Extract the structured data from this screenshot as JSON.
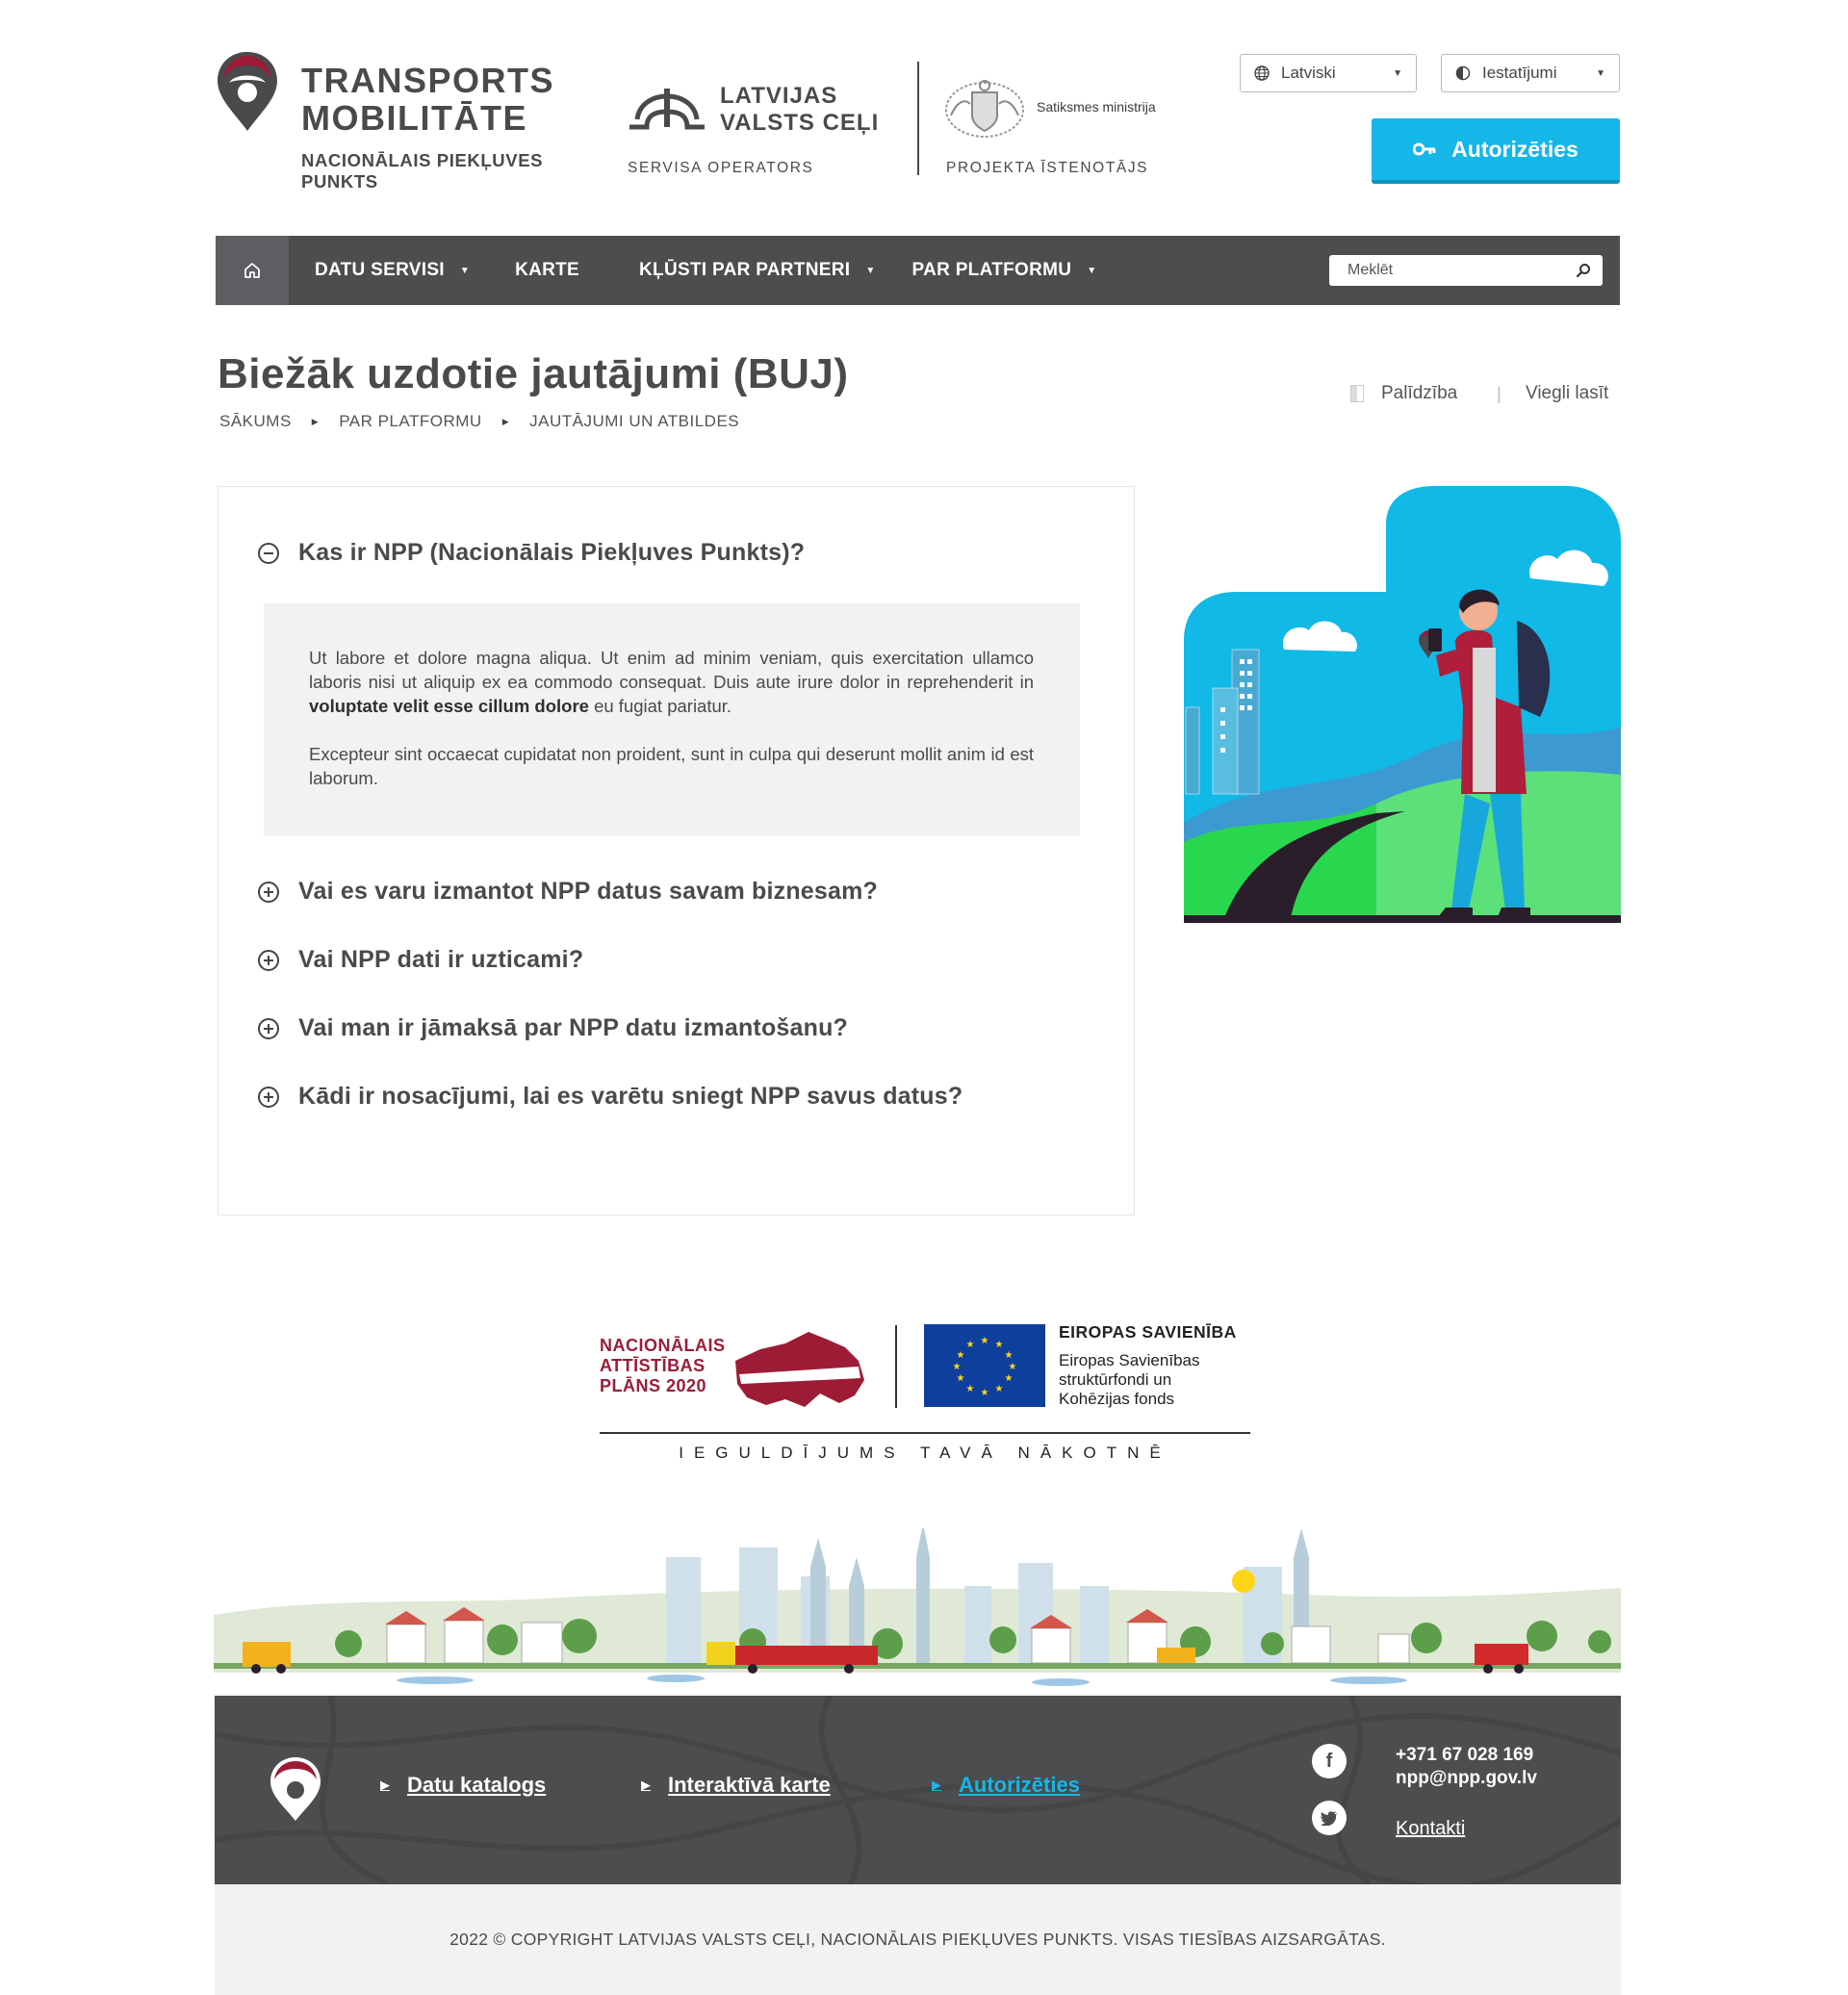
{
  "brand": {
    "title": "TRANSPORTS\nMOBILITĀTE",
    "subtitle": "NACIONĀLAIS PIEKĻUVES PUNKTS",
    "operator_name": "LATVIJAS\nVALSTS CEĻI",
    "operator_label": "SERVISA OPERATORS",
    "ministry_name": "Satiksmes ministrija",
    "implementer_label": "PROJEKTA ĪSTENOTĀJS",
    "accent_color": "#9c1c36"
  },
  "header": {
    "language_select": "Latviski",
    "settings_select": "Iestatījumi",
    "auth_button": "Autorizēties",
    "auth_color": "#15b6e8"
  },
  "nav": {
    "items": [
      {
        "label": "DATU SERVISI",
        "dropdown": true
      },
      {
        "label": "KARTE",
        "dropdown": false
      },
      {
        "label": "KĻŪSTI PAR PARTNERI",
        "dropdown": true
      },
      {
        "label": "PAR PLATFORMU",
        "dropdown": true
      }
    ],
    "search_placeholder": "Meklēt",
    "bg_color": "#4c4d4f"
  },
  "page": {
    "title": "Biežāk uzdotie jautājumi (BUJ)",
    "breadcrumb": [
      "SĀKUMS",
      "PAR PLATFORMU",
      "JAUTĀJUMI UN ATBILDES"
    ],
    "help_link": "Palīdzība",
    "easy_read_link": "Viegli lasīt"
  },
  "faq": {
    "items": [
      {
        "question": "Kas ir NPP (Nacionālais Piekļuves Punkts)?",
        "expanded": true
      },
      {
        "question": "Vai es varu izmantot NPP datus savam biznesam?",
        "expanded": false
      },
      {
        "question": "Vai NPP dati ir uzticami?",
        "expanded": false
      },
      {
        "question": "Vai man ir jāmaksā par NPP datu izmantošanu?",
        "expanded": false
      },
      {
        "question": "Kādi ir nosacījumi, lai es varētu sniegt NPP savus datus?",
        "expanded": false
      }
    ],
    "answer": {
      "p1_before": "Ut labore et dolore magna aliqua. Ut enim ad minim veniam, quis exercitation ullamco laboris nisi ut aliquip ex ea commodo consequat. Duis aute irure dolor in reprehenderit in ",
      "p1_bold": "voluptate velit esse cillum dolore",
      "p1_after": " eu fugiat pariatur.",
      "p2": "Excepteur sint occaecat cupidatat non proident, sunt in culpa qui deserunt mollit anim id est laborum."
    }
  },
  "funding": {
    "nap_text": "NACIONĀLAIS\nATTĪSTĪBAS\nPLĀNS 2020",
    "eu_title": "EIROPAS SAVIENĪBA",
    "eu_sub": "Eiropas Savienības\nstruktūrfondi un\nKohēzijas fonds",
    "tagline": "IEGULDĪJUMS TAVĀ NĀKOTNĒ"
  },
  "footer": {
    "links": [
      "Datu katalogs",
      "Interaktīvā karte",
      "Autorizēties"
    ],
    "phone": "+371 67 028 169",
    "email": "npp@npp.gov.lv",
    "contacts_link": "Kontakti",
    "social": [
      "facebook-icon",
      "twitter-icon"
    ],
    "copyright": "2022 © COPYRIGHT LATVIJAS VALSTS CEĻI, NACIONĀLAIS PIEKĻUVES PUNKTS. VISAS TIESĪBAS AIZSARGĀTAS."
  }
}
